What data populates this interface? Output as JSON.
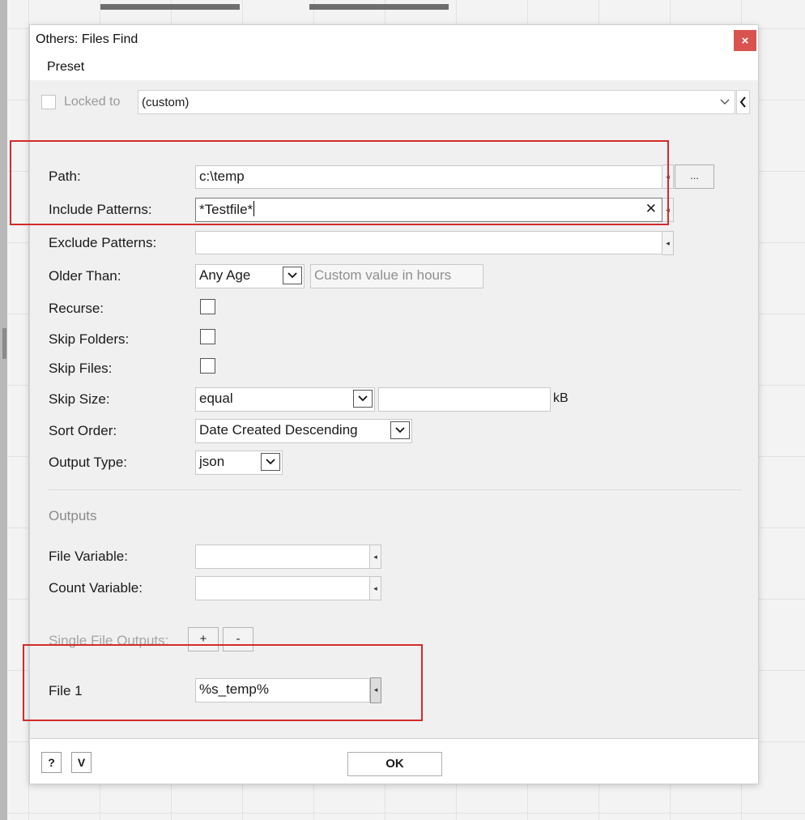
{
  "dialog": {
    "title": "Others: Files Find",
    "close_glyph": "×",
    "menu": [
      "Preset"
    ]
  },
  "lock": {
    "label": "Locked to",
    "value": "(custom)",
    "checked": false
  },
  "fields": {
    "path": {
      "label": "Path:",
      "value": "c:\\temp",
      "browse_label": "..."
    },
    "include": {
      "label": "Include Patterns:",
      "value": "*Testfile*",
      "clear_glyph": "✕"
    },
    "exclude": {
      "label": "Exclude Patterns:",
      "value": ""
    },
    "older_than": {
      "label": "Older Than:",
      "value": "Any Age",
      "custom_placeholder": "Custom value in hours"
    },
    "recurse": {
      "label": "Recurse:",
      "checked": false
    },
    "skip_folders": {
      "label": "Skip Folders:",
      "checked": false
    },
    "skip_files": {
      "label": "Skip Files:",
      "checked": false
    },
    "skip_size": {
      "label": "Skip Size:",
      "comparator": "equal",
      "value": "",
      "unit": "kB"
    },
    "sort_order": {
      "label": "Sort Order:",
      "value": "Date Created Descending"
    },
    "output_type": {
      "label": "Output Type:",
      "value": "json"
    }
  },
  "outputs": {
    "heading": "Outputs",
    "file_variable": {
      "label": "File Variable:",
      "value": ""
    },
    "count_variable": {
      "label": "Count Variable:",
      "value": ""
    },
    "single_file_outputs": {
      "label": "Single File Outputs:",
      "add_label": "+",
      "remove_label": "-"
    },
    "file1": {
      "label": "File 1",
      "value": "%s_temp%"
    }
  },
  "footer": {
    "help_label": "?",
    "expand_label": "V",
    "ok_label": "OK"
  },
  "colors": {
    "highlight": "#d42a2a",
    "close_button": "#d9534f"
  }
}
